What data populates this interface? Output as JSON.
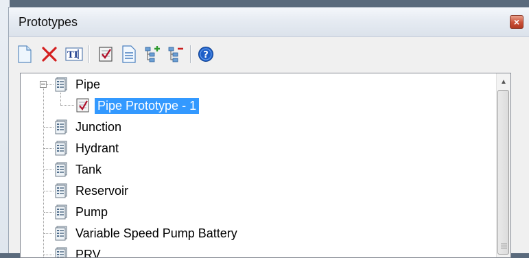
{
  "window": {
    "title": "Prototypes",
    "close_glyph": "×"
  },
  "toolbar": {
    "buttons": [
      {
        "icon": "new-document-icon"
      },
      {
        "icon": "delete-icon"
      },
      {
        "icon": "rename-icon"
      },
      {
        "icon": "make-current-icon"
      },
      {
        "icon": "report-icon"
      },
      {
        "icon": "expand-all-icon"
      },
      {
        "icon": "collapse-all-icon"
      },
      {
        "icon": "help-icon"
      }
    ],
    "accent_delete": "#d42020",
    "accent_help": "#1e5fc8"
  },
  "tree": {
    "items": [
      {
        "label": "Pipe",
        "level": 0,
        "expanded": true
      },
      {
        "label": "Pipe Prototype - 1",
        "level": 1,
        "selected": true
      },
      {
        "label": "Junction",
        "level": 0
      },
      {
        "label": "Hydrant",
        "level": 0
      },
      {
        "label": "Tank",
        "level": 0
      },
      {
        "label": "Reservoir",
        "level": 0
      },
      {
        "label": "Pump",
        "level": 0
      },
      {
        "label": "Variable Speed Pump Battery",
        "level": 0
      },
      {
        "label": "PRV",
        "level": 0
      }
    ],
    "selection_color": "#3399ff"
  }
}
